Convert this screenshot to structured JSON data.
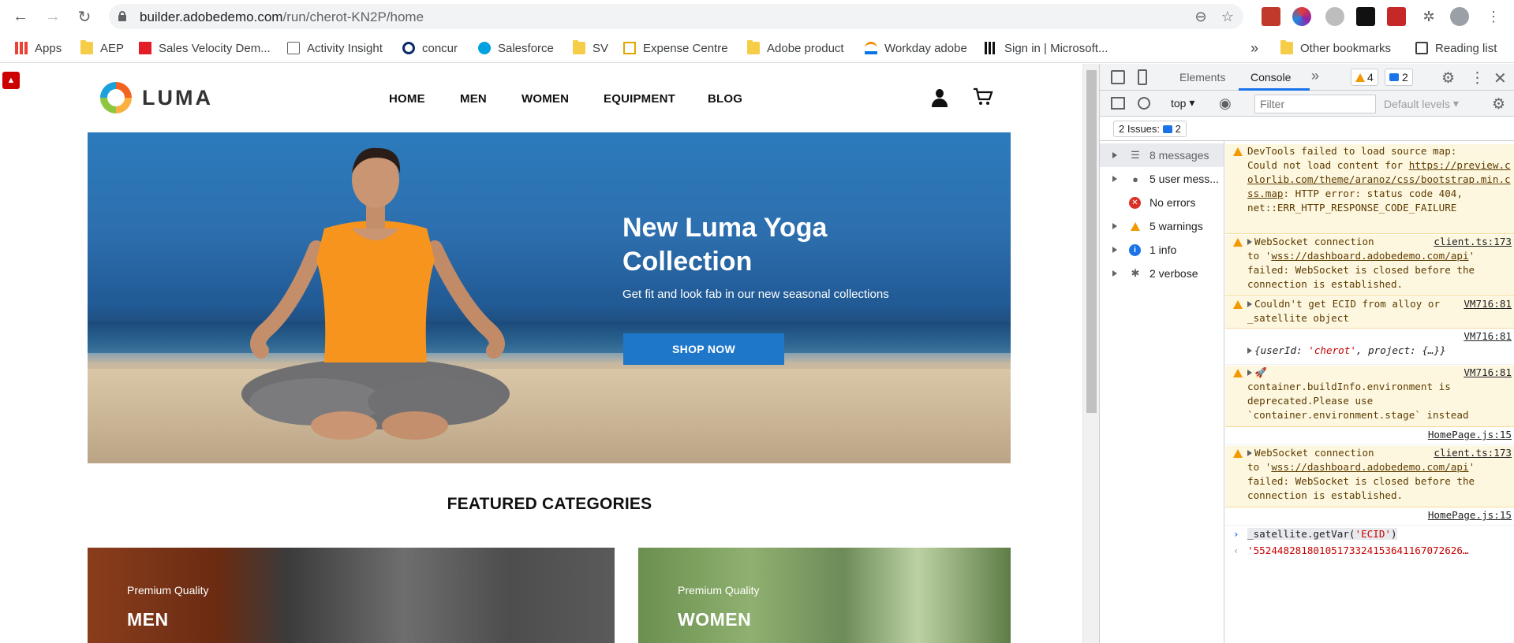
{
  "browser": {
    "url_domain": "builder.adobedemo.com",
    "url_path": "/run/cherot-KN2P/home",
    "bookmarks": [
      {
        "label": "Apps",
        "icon": "apps-grid-icon"
      },
      {
        "label": "AEP",
        "icon": "folder-icon"
      },
      {
        "label": "Sales Velocity Dem...",
        "icon": "adobe-icon"
      },
      {
        "label": "Activity Insight",
        "icon": "checkbox-icon"
      },
      {
        "label": "concur",
        "icon": "concur-icon"
      },
      {
        "label": "Salesforce",
        "icon": "salesforce-icon"
      },
      {
        "label": "SV",
        "icon": "folder-icon"
      },
      {
        "label": "Expense Centre",
        "icon": "expense-icon"
      },
      {
        "label": "Adobe product",
        "icon": "folder-icon"
      },
      {
        "label": "Workday adobe",
        "icon": "workday-icon"
      },
      {
        "label": "Sign in | Microsoft...",
        "icon": "bars-icon"
      }
    ],
    "more_bookmarks": "»",
    "other_bookmarks": "Other bookmarks",
    "reading_list": "Reading list"
  },
  "site": {
    "logo_text": "LUMA",
    "nav": [
      "HOME",
      "MEN",
      "WOMEN",
      "EQUIPMENT",
      "BLOG"
    ],
    "hero_title": "New Luma Yoga Collection",
    "hero_subtitle": "Get fit and look fab in our new seasonal collections",
    "hero_button": "SHOP NOW",
    "featured_heading": "FEATURED CATEGORIES",
    "categories": [
      {
        "tag": "Premium Quality",
        "name": "MEN"
      },
      {
        "tag": "Premium Quality",
        "name": "WOMEN"
      }
    ]
  },
  "devtools": {
    "tabs": [
      "Elements",
      "Console"
    ],
    "active_tab": "Console",
    "more_tabs": "»",
    "warn_count": "4",
    "msg_count": "2",
    "context": "top",
    "filter_placeholder": "Filter",
    "levels": "Default levels",
    "issues_label": "2 Issues:",
    "issues_count": "2",
    "sidebar": [
      {
        "label": "8 messages",
        "icon": "list-icon"
      },
      {
        "label": "5 user mess...",
        "icon": "user-icon"
      },
      {
        "label": "No errors",
        "icon": "error-icon"
      },
      {
        "label": "5 warnings",
        "icon": "warning-icon"
      },
      {
        "label": "1 info",
        "icon": "info-icon"
      },
      {
        "label": "2 verbose",
        "icon": "bug-icon"
      }
    ],
    "console": {
      "m1_l1": "DevTools failed to load source map:",
      "m1_l2": "Could not load content for ",
      "m1_link": "https://preview.colorlib.com/theme/aranoz/css/bootstrap.min.css.map",
      "m1_rest": ": HTTP error: status code 404, net::ERR_HTTP_RESPONSE_CODE_FAILURE",
      "m2_text": "WebSocket connection",
      "m2_src": "client.ts:173",
      "m2_to": "to '",
      "m2_link": "wss://dashboard.adobedemo.com/api",
      "m2_rest": "' failed: WebSocket is closed before the connection is established.",
      "m3_text": "Couldn't get ECID from alloy or _satellite object",
      "m3_src": "VM716:81",
      "m4_src": "VM716:81",
      "m4_obj_pre": "{userId: ",
      "m4_obj_str": "'cherot'",
      "m4_obj_post": ", project: {…}}",
      "m5_src": "VM716:81",
      "m5_text": "container.buildInfo.environment is deprecated.Please use `container.environment.stage` instead",
      "m6_src": "HomePage.js:15",
      "m7_text": "WebSocket connection",
      "m7_src": "client.ts:173",
      "m7_to": "to '",
      "m7_link": "wss://dashboard.adobedemo.com/api",
      "m7_rest": "' failed: WebSocket is closed before the connection is established.",
      "m8_src": "HomePage.js:15",
      "input_pre": "_satellite.getVar(",
      "input_str": "'ECID'",
      "input_post": ")",
      "result": "'55244828180105173324153641167072626…"
    }
  }
}
